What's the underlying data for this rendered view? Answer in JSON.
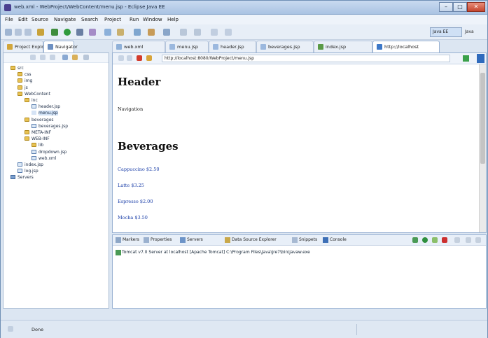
{
  "window": {
    "title": "web.xml - WebProject/WebContent/menu.jsp - Eclipse Java EE",
    "minimize": "–",
    "maximize": "□",
    "close": "✕"
  },
  "menu": [
    "File",
    "Edit",
    "Source",
    "Navigate",
    "Search",
    "Project",
    "Run",
    "Window",
    "Help"
  ],
  "toolbar": {
    "perspective_label": "Java EE",
    "quick_label": "Java"
  },
  "tabs": [
    {
      "label": "Project Explorer"
    },
    {
      "label": "Navigator"
    },
    {
      "label": "web.xml"
    },
    {
      "label": "menu.jsp"
    },
    {
      "label": "header.jsp"
    },
    {
      "label": "beverages.jsp"
    },
    {
      "label": "index.jsp"
    },
    {
      "label": "http://localhost"
    }
  ],
  "tree": [
    {
      "label": "src",
      "indent": 0,
      "kind": "folder"
    },
    {
      "label": "css",
      "indent": 1,
      "kind": "folder"
    },
    {
      "label": "img",
      "indent": 1,
      "kind": "folder"
    },
    {
      "label": "js",
      "indent": 1,
      "kind": "folder"
    },
    {
      "label": "WebContent",
      "indent": 1,
      "kind": "folder"
    },
    {
      "label": "inc",
      "indent": 2,
      "kind": "folder"
    },
    {
      "label": "header.jsp",
      "indent": 3,
      "kind": "jsp"
    },
    {
      "label": "menu.jsp",
      "indent": 3,
      "kind": "sel"
    },
    {
      "label": "beverages",
      "indent": 2,
      "kind": "folder"
    },
    {
      "label": "beverages.jsp",
      "indent": 3,
      "kind": "jsp"
    },
    {
      "label": "META-INF",
      "indent": 2,
      "kind": "folder"
    },
    {
      "label": "WEB-INF",
      "indent": 2,
      "kind": "folder"
    },
    {
      "label": "lib",
      "indent": 3,
      "kind": "folder"
    },
    {
      "label": "dropdown.jsp",
      "indent": 3,
      "kind": "jsp"
    },
    {
      "label": "web.xml",
      "indent": 3,
      "kind": "jsp"
    },
    {
      "label": "index.jsp",
      "indent": 1,
      "kind": "jsp"
    },
    {
      "label": "log.jsp",
      "indent": 1,
      "kind": "jsp"
    },
    {
      "label": "Servers",
      "indent": 0,
      "kind": "servers"
    }
  ],
  "browser": {
    "url": "http://localhost:8080/WebProject/menu.jsp"
  },
  "page": {
    "header": "Header",
    "navigation": "Navigation",
    "beverages_heading": "Beverages",
    "items": [
      "Cappuccino $2.50",
      "Latte $3.25",
      "Espresso $2.00",
      "Mocha $3.50"
    ]
  },
  "console_tabs": [
    {
      "label": "Markers"
    },
    {
      "label": "Properties"
    },
    {
      "label": "Servers"
    },
    {
      "label": "Data Source Explorer"
    },
    {
      "label": "Snippets"
    },
    {
      "label": "Console"
    }
  ],
  "console": {
    "line": "Tomcat v7.0 Server at localhost [Apache Tomcat] C:\\Program Files\\Java\\jre7\\bin\\javaw.exe"
  },
  "status": {
    "text": "Done"
  }
}
